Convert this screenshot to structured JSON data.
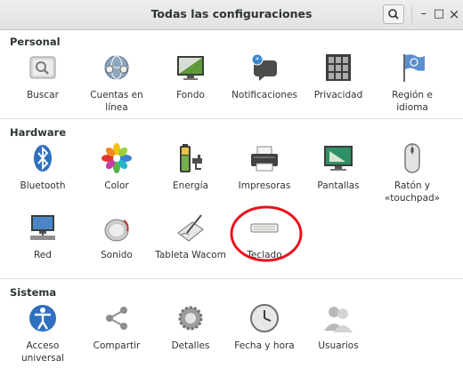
{
  "window": {
    "title": "Todas las configuraciones",
    "search_icon": "search-icon",
    "minimize": "–",
    "maximize": "□",
    "close": "×"
  },
  "sections": {
    "personal": "Personal",
    "hardware": "Hardware",
    "sistema": "Sistema"
  },
  "personal": {
    "buscar": "Buscar",
    "cuentas": "Cuentas en línea",
    "fondo": "Fondo",
    "notificaciones": "Notificaciones",
    "privacidad": "Privacidad",
    "region": "Región e idioma"
  },
  "hardware": {
    "bluetooth": "Bluetooth",
    "color": "Color",
    "energia": "Energía",
    "impresoras": "Impresoras",
    "pantallas": "Pantallas",
    "raton": "Ratón y «touchpad»",
    "red": "Red",
    "sonido": "Sonido",
    "tableta": "Tableta Wacom",
    "teclado": "Teclado"
  },
  "sistema": {
    "acceso": "Acceso universal",
    "compartir": "Compartir",
    "detalles": "Detalles",
    "fecha": "Fecha y hora",
    "usuarios": "Usuarios"
  },
  "colors": {
    "annotation": "#e8101a",
    "accent": "#3584e4"
  }
}
